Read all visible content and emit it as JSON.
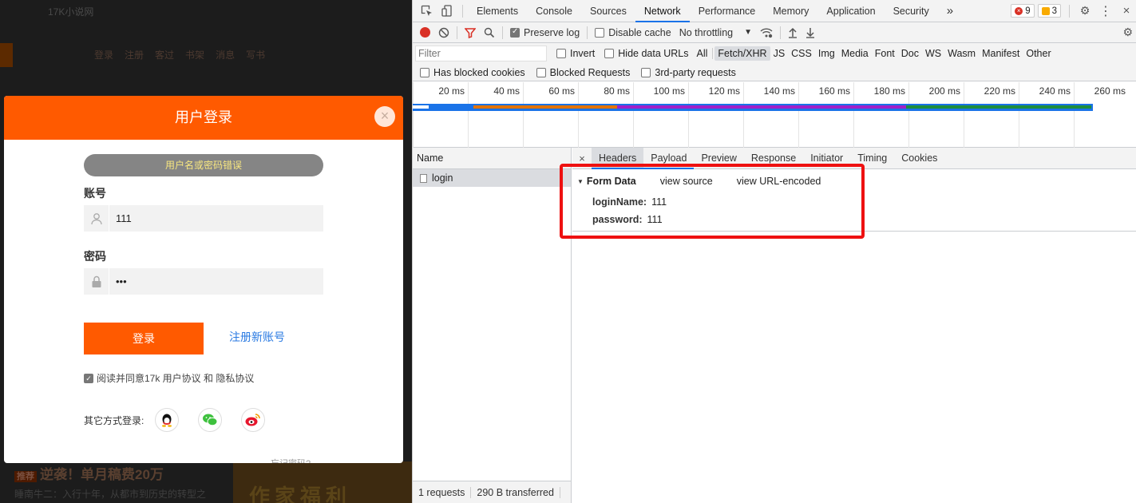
{
  "site": {
    "topbar_text": "17K小说网",
    "nav": [
      "登录",
      "注册",
      "客过",
      "书架",
      "消息",
      "写书"
    ],
    "promo_tag": "推荐",
    "promo_title": "逆袭！单月稿费20万",
    "promo_sub": "睡南牛二：入行十年，从都市到历史的转型之",
    "banner_text": "作家福利"
  },
  "login": {
    "title": "用户登录",
    "close": "×",
    "error_message": "用户名或密码错误",
    "account_label": "账号",
    "account_value": "111",
    "password_label": "密码",
    "password_value": "•••",
    "submit": "登录",
    "register": "注册新账号",
    "agree_text": "阅读并同意17k 用户协议 和 隐私协议",
    "other_label": "其它方式登录:",
    "social": [
      "qq-icon",
      "wechat-icon",
      "weibo-icon"
    ],
    "bottom_cut": "忘记密码?"
  },
  "devtools": {
    "tabs": [
      "Elements",
      "Console",
      "Sources",
      "Network",
      "Performance",
      "Memory",
      "Application",
      "Security"
    ],
    "active_tab": "Network",
    "more": "»",
    "errors": "9",
    "warnings": "3",
    "toolbar": {
      "preserve_log": "Preserve log",
      "disable_cache": "Disable cache",
      "throttling": "No throttling"
    },
    "filter": {
      "placeholder": "Filter",
      "invert": "Invert",
      "hide_data_urls": "Hide data URLs",
      "types": [
        "All",
        "Fetch/XHR",
        "JS",
        "CSS",
        "Img",
        "Media",
        "Font",
        "Doc",
        "WS",
        "Wasm",
        "Manifest",
        "Other"
      ],
      "active_type": "Fetch/XHR",
      "has_blocked_cookies": "Has blocked cookies",
      "blocked_requests": "Blocked Requests",
      "third_party": "3rd-party requests"
    },
    "overview_ticks": [
      "20 ms",
      "40 ms",
      "60 ms",
      "80 ms",
      "100 ms",
      "120 ms",
      "140 ms",
      "160 ms",
      "180 ms",
      "200 ms",
      "220 ms",
      "240 ms",
      "260 ms"
    ],
    "requests": {
      "header": "Name",
      "items": [
        "login"
      ],
      "count": "1 requests",
      "transferred": "290 B transferred"
    },
    "details": {
      "close": "×",
      "tabs": [
        "Headers",
        "Payload",
        "Preview",
        "Response",
        "Initiator",
        "Timing",
        "Cookies"
      ],
      "form_data": {
        "title": "Form Data",
        "view_source": "view source",
        "view_url": "view URL-encoded",
        "fields": [
          {
            "key": "loginName:",
            "value": "111"
          },
          {
            "key": "password:",
            "value": "111"
          }
        ]
      }
    }
  }
}
